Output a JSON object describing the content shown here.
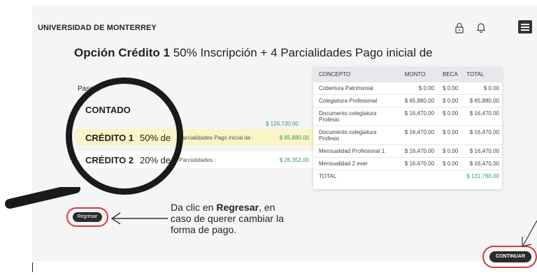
{
  "header": {
    "brand": "UNIVERSIDAD DE MONTERREY",
    "icons": [
      "lock-icon",
      "bell-icon",
      "menu-icon"
    ]
  },
  "heading": {
    "bold": "Opción Crédito 1",
    "rest": "50% Inscripción + 4 Parcialidades Pago inicial de"
  },
  "step": "Paso 1",
  "options": [
    {
      "name": "CONTADO",
      "percent": "",
      "desc": "",
      "amount": "$ 126,720.00"
    },
    {
      "name": "CRÉDITO 1",
      "percent": "50% de",
      "desc": "Parcialidades Pago inicial de :",
      "amount": "$ 65,880.00"
    },
    {
      "name": "CRÉDITO 2",
      "percent": "20% de",
      "desc": "Parcialidades :",
      "amount": "$ 26,352.00"
    }
  ],
  "table": {
    "headers": [
      "CONCEPTO",
      "MONTO",
      "BECA",
      "TOTAL"
    ],
    "rows": [
      [
        "Cobertura Patrimonial",
        "$ 0.00",
        "$ 0.00",
        "$ 0.00"
      ],
      [
        "Colegiatura Profesional",
        "$ 65,880.00",
        "$ 0.00",
        "$ 65,880.00"
      ],
      [
        "Documento colegiatura Profesio",
        "$ 16,470.00",
        "$ 0.00",
        "$ 16,470.00"
      ],
      [
        "Documento colegiatura Profesio",
        "$ 16,470.00",
        "$ 0.00",
        "$ 16,470.00"
      ],
      [
        "Mensualidad Profesional 1",
        "$ 16,470.00",
        "$ 0.00",
        "$ 16,470.00"
      ],
      [
        "Mensualidad 2 ever",
        "$ 16,470.00",
        "$ 0.00",
        "$ 16,470.00"
      ]
    ],
    "total_label": "TOTAL",
    "total_value": "$ 131,760.00"
  },
  "buttons": {
    "regresar": "Regresar",
    "continuar": "CONTINUAR"
  },
  "callout": {
    "prefix": "Da clic en ",
    "bold": "Regresar",
    "suffix": ", en caso de querer cambiar la forma de pago."
  },
  "colors": {
    "accent_green": "#2e9a5a",
    "highlight": "#fbf4c7",
    "ring_red": "#d63c3c",
    "dark": "#2b2b2b"
  }
}
